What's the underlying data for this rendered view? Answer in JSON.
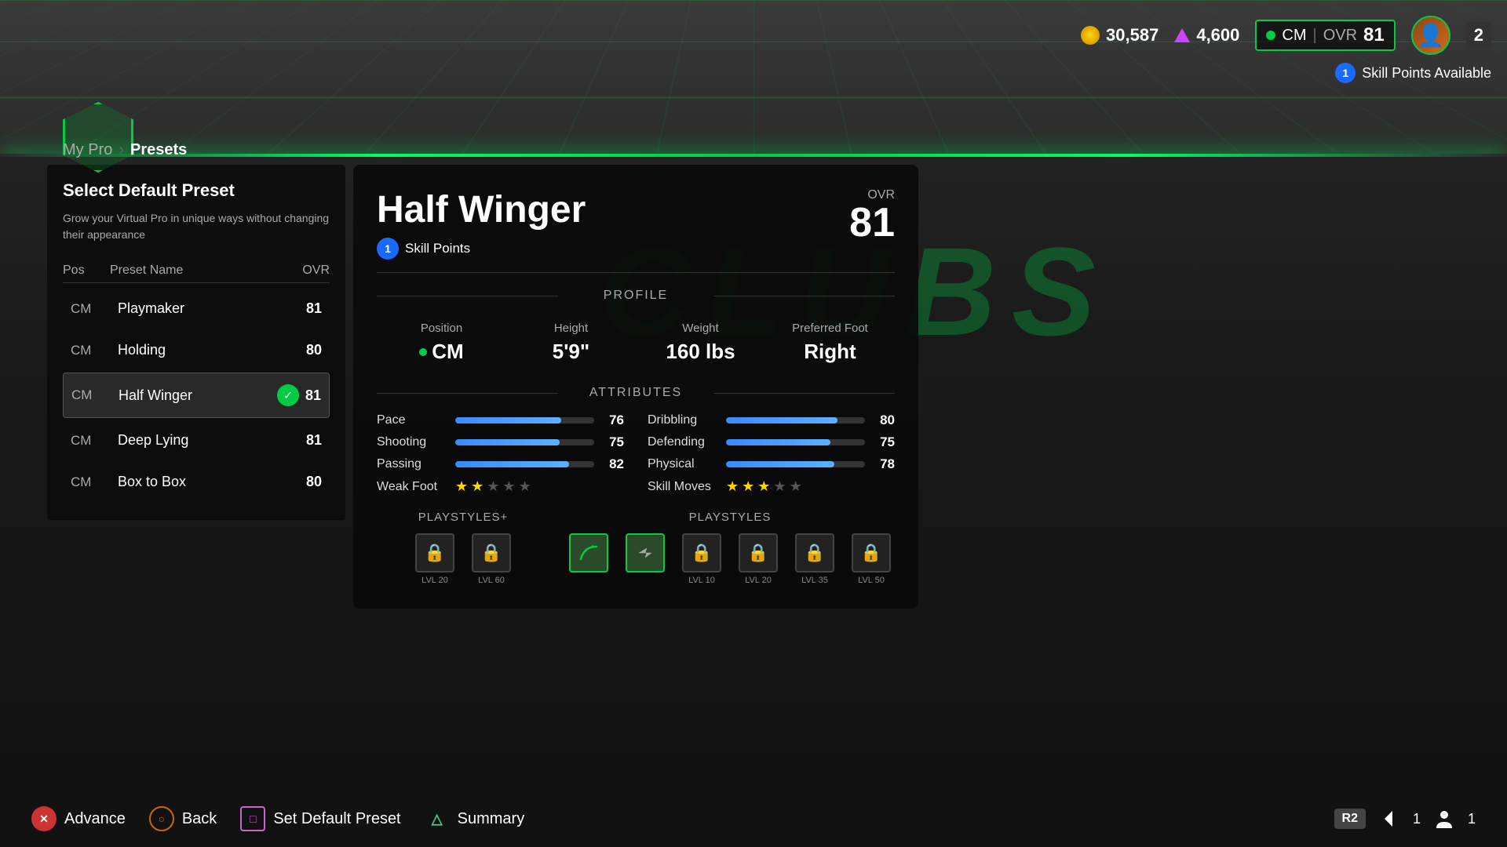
{
  "bg": {
    "clubs_text": "CLUBS"
  },
  "hud": {
    "coins": "30,587",
    "tokens": "4,600",
    "position": "CM",
    "ovr": "81",
    "level": "2",
    "skill_points_available": "1",
    "skill_points_label": "Skill Points Available"
  },
  "breadcrumb": {
    "parent": "My Pro",
    "current": "Presets"
  },
  "left_panel": {
    "title": "Select Default Preset",
    "description": "Grow your Virtual Pro in unique ways without changing their appearance",
    "table_headers": {
      "pos": "Pos",
      "preset_name": "Preset Name",
      "ovr": "OVR"
    },
    "presets": [
      {
        "pos": "CM",
        "name": "Playmaker",
        "ovr": "81",
        "active": false
      },
      {
        "pos": "CM",
        "name": "Holding",
        "ovr": "80",
        "active": false
      },
      {
        "pos": "CM",
        "name": "Half Winger",
        "ovr": "81",
        "active": true
      },
      {
        "pos": "CM",
        "name": "Deep Lying",
        "ovr": "81",
        "active": false
      },
      {
        "pos": "CM",
        "name": "Box to Box",
        "ovr": "80",
        "active": false
      }
    ]
  },
  "main_card": {
    "title": "Half Winger",
    "ovr_label": "OVR",
    "ovr_value": "81",
    "skill_points_count": "1",
    "skill_points_label": "Skill Points",
    "profile": {
      "section_label": "Profile",
      "position_label": "Position",
      "position_value": "CM",
      "height_label": "Height",
      "height_value": "5'9\"",
      "weight_label": "Weight",
      "weight_value": "160 lbs",
      "preferred_foot_label": "Preferred Foot",
      "preferred_foot_value": "Right"
    },
    "attributes": {
      "section_label": "Attributes",
      "stats": [
        {
          "label": "Pace",
          "value": 76,
          "max": 99,
          "side": "left"
        },
        {
          "label": "Dribbling",
          "value": 80,
          "max": 99,
          "side": "right"
        },
        {
          "label": "Shooting",
          "value": 75,
          "max": 99,
          "side": "left"
        },
        {
          "label": "Defending",
          "value": 75,
          "max": 99,
          "side": "right"
        },
        {
          "label": "Passing",
          "value": 82,
          "max": 99,
          "side": "left"
        },
        {
          "label": "Physical",
          "value": 78,
          "max": 99,
          "side": "right"
        },
        {
          "label": "Weak Foot",
          "stars": 2,
          "max_stars": 5,
          "side": "left"
        },
        {
          "label": "Skill Moves",
          "stars": 3,
          "max_stars": 5,
          "side": "right"
        }
      ]
    },
    "playstyles_plus": {
      "label": "PlayStyles+",
      "icons": [
        {
          "locked": true,
          "level": "LVL 20"
        },
        {
          "locked": true,
          "level": "LVL 60"
        }
      ]
    },
    "playstyles": {
      "label": "PlayStyles",
      "icons": [
        {
          "locked": false,
          "symbol": "curve"
        },
        {
          "locked": false,
          "symbol": "sprint"
        },
        {
          "locked": true,
          "level": "LVL 10"
        },
        {
          "locked": true,
          "level": "LVL 20"
        },
        {
          "locked": true,
          "level": "LVL 35"
        },
        {
          "locked": true,
          "level": "LVL 50"
        }
      ]
    }
  },
  "bottom_nav": {
    "advance": "Advance",
    "back": "Back",
    "set_default": "Set Default Preset",
    "summary": "Summary",
    "nav_num_1": "1",
    "nav_num_2": "1"
  }
}
